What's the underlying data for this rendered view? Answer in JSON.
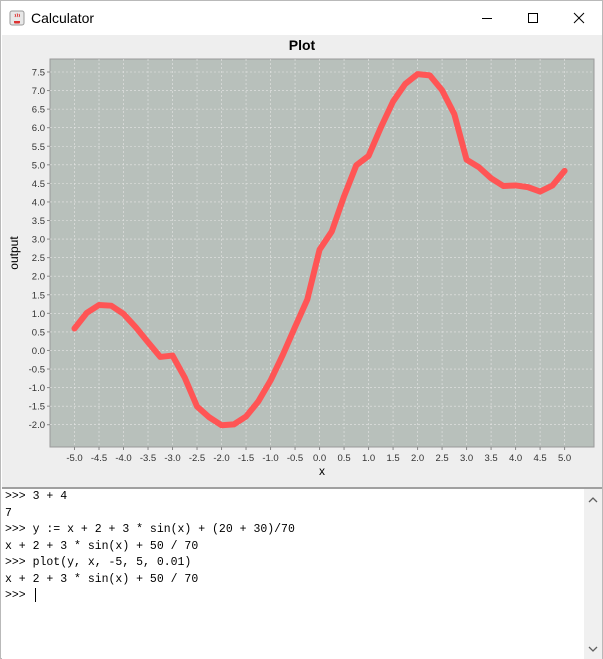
{
  "window": {
    "title": "Calculator",
    "icons": {
      "app": "java-coffee-icon",
      "minimize": "minimize-icon",
      "maximize": "maximize-icon",
      "close": "close-icon"
    }
  },
  "chart_data": {
    "type": "line",
    "title": "Plot",
    "xlabel": "x",
    "ylabel": "output",
    "xlim": [
      -5.5,
      5.6
    ],
    "ylim": [
      -2.6,
      7.85
    ],
    "grid": true,
    "xticks": [
      "-5.0",
      "-4.5",
      "-4.0",
      "-3.5",
      "-3.0",
      "-2.5",
      "-2.0",
      "-1.5",
      "-1.0",
      "-0.5",
      "0.0",
      "0.5",
      "1.0",
      "1.5",
      "2.0",
      "2.5",
      "3.0",
      "3.5",
      "4.0",
      "4.5",
      "5.0"
    ],
    "yticks": [
      "-2.0",
      "-1.5",
      "-1.0",
      "-0.5",
      "0.0",
      "0.5",
      "1.0",
      "1.5",
      "2.0",
      "2.5",
      "3.0",
      "3.5",
      "4.0",
      "4.5",
      "5.0",
      "5.5",
      "6.0",
      "6.5",
      "7.0",
      "7.5"
    ],
    "series": [
      {
        "color": "#ff5555",
        "x": [
          -5.0,
          -4.75,
          -4.5,
          -4.25,
          -4.0,
          -3.75,
          -3.5,
          -3.25,
          -3.0,
          -2.75,
          -2.5,
          -2.25,
          -2.0,
          -1.75,
          -1.5,
          -1.25,
          -1.0,
          -0.75,
          -0.5,
          -0.25,
          0.0,
          0.25,
          0.5,
          0.75,
          1.0,
          1.25,
          1.5,
          1.75,
          2.0,
          2.25,
          2.5,
          2.75,
          3.0,
          3.25,
          3.5,
          3.75,
          4.0,
          4.25,
          4.5,
          4.75,
          5.0
        ],
        "y": [
          0.591,
          1.012,
          1.224,
          1.206,
          0.985,
          0.626,
          0.222,
          -0.174,
          -0.137,
          -0.734,
          -1.509,
          -1.801,
          -2.014,
          -1.992,
          -1.778,
          -1.373,
          -0.81,
          -0.12,
          0.634,
          1.372,
          2.714,
          3.206,
          4.152,
          4.988,
          5.239,
          6.004,
          6.705,
          7.181,
          7.442,
          7.409,
          7.009,
          6.366,
          5.137,
          4.936,
          4.639,
          4.429,
          4.444,
          4.399,
          4.279,
          4.44,
          4.838
        ]
      }
    ]
  },
  "console": {
    "lines": [
      ">>> 3 + 4",
      "7",
      ">>> y := x + 2 + 3 * sin(x) + (20 + 30)/70",
      "x + 2 + 3 * sin(x) + 50 / 70",
      ">>> plot(y, x, -5, 5, 0.01)",
      "x + 2 + 3 * sin(x) + 50 / 70",
      ">>> "
    ]
  }
}
